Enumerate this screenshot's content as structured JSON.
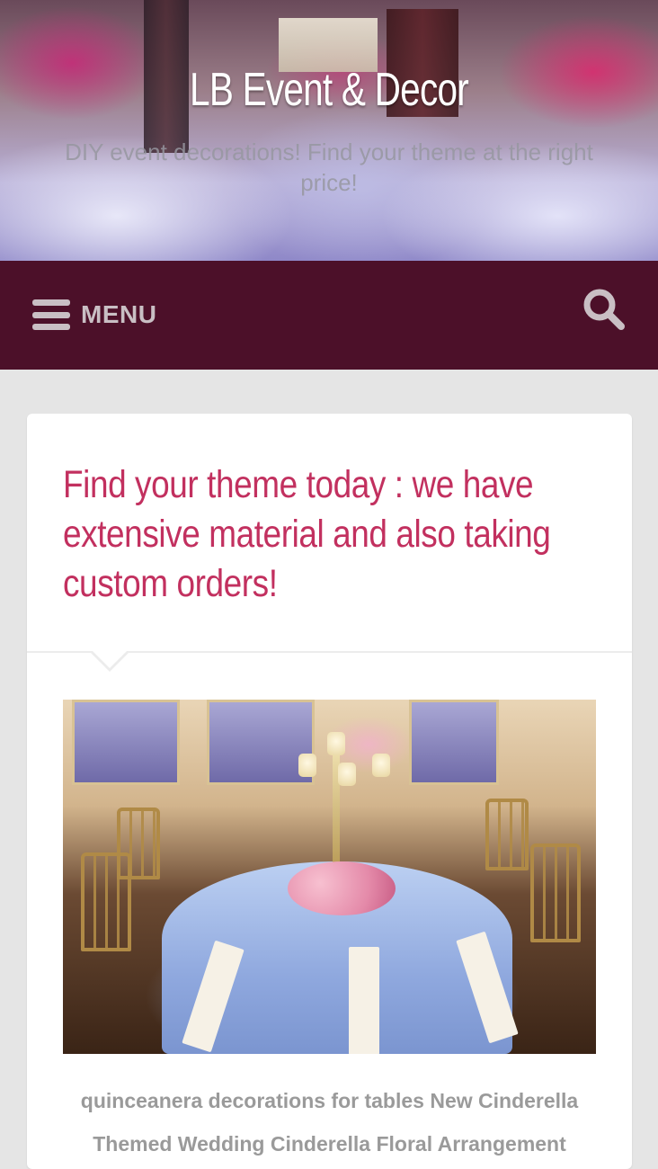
{
  "site": {
    "title": "LB Event & Decor",
    "tagline": "DIY event decorations! Find your theme at the right price!"
  },
  "nav": {
    "menu_label": "MENU",
    "menu_icon": "hamburger-icon",
    "search_icon": "search-icon"
  },
  "post": {
    "title": "Find your theme today : we have extensive material and also taking custom orders!",
    "image_caption": "quinceanera decorations for tables New Cinderella Themed Wedding Cinderella Floral Arrangement"
  },
  "colors": {
    "navbar": "#4c1029",
    "title_accent": "#c2305f",
    "page_background": "#e5e5e5",
    "nav_text": "#c9bfc4",
    "caption_text": "#9a9a9a"
  }
}
